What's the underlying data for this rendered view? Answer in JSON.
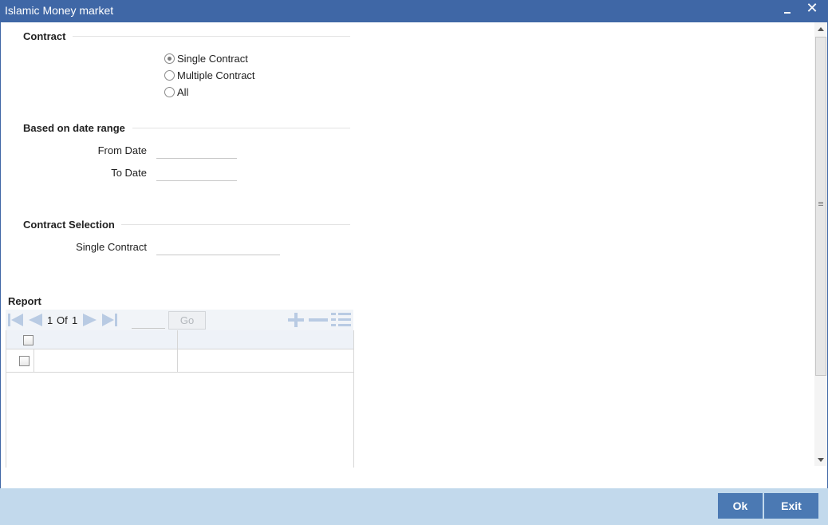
{
  "window": {
    "title": "Islamic Money market"
  },
  "contract": {
    "title": "Contract",
    "options": [
      {
        "label": "Single Contract",
        "checked": true
      },
      {
        "label": "Multiple Contract",
        "checked": false
      },
      {
        "label": "All",
        "checked": false
      }
    ]
  },
  "date_range": {
    "title": "Based on date range",
    "from_label": "From Date",
    "from_value": "",
    "to_label": "To Date",
    "to_value": ""
  },
  "contract_selection": {
    "title": "Contract Selection",
    "single_label": "Single Contract",
    "single_value": ""
  },
  "report": {
    "title": "Report",
    "page_current": "1",
    "page_of": "Of",
    "page_total": "1",
    "page_input": "",
    "go_label": "Go",
    "rows": [
      {
        "checked": false
      }
    ]
  },
  "footer": {
    "ok_label": "Ok",
    "exit_label": "Exit"
  },
  "colors": {
    "titlebar": "#3f67a6",
    "footer": "#c2d9ec",
    "button": "#4b79b3"
  }
}
